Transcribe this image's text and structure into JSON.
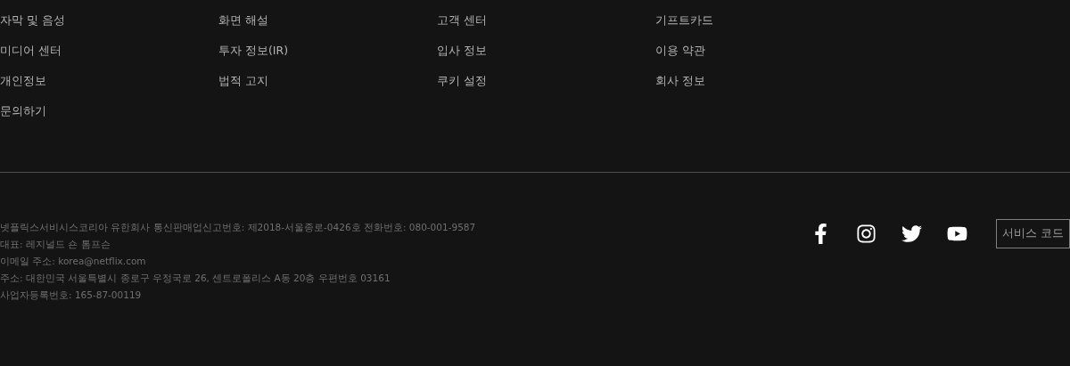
{
  "links": [
    "자막 및 음성",
    "화면 해설",
    "고객 센터",
    "기프트카드",
    "미디어 센터",
    "투자 정보(IR)",
    "입사 정보",
    "이용 약관",
    "개인정보",
    "법적 고지",
    "쿠키 설정",
    "회사 정보",
    "문의하기"
  ],
  "company_info": [
    "넷플릭스서비시스코리아 유한회사 통신판매업신고번호: 제2018-서울종로-0426호 전화번호: 080-001-9587",
    "대표: 레지널드 숀 톰프슨",
    "이메일 주소: korea@netflix.com",
    "주소: 대한민국 서울특별시 종로구 우정국로 26, 센트로폴리스 A동 20층 우편번호 03161",
    "사업자등록번호: 165-87-00119"
  ],
  "social": [
    {
      "kind": "facebook"
    },
    {
      "kind": "instagram"
    },
    {
      "kind": "twitter"
    },
    {
      "kind": "youtube"
    }
  ],
  "service_code_button": "서비스 코드"
}
